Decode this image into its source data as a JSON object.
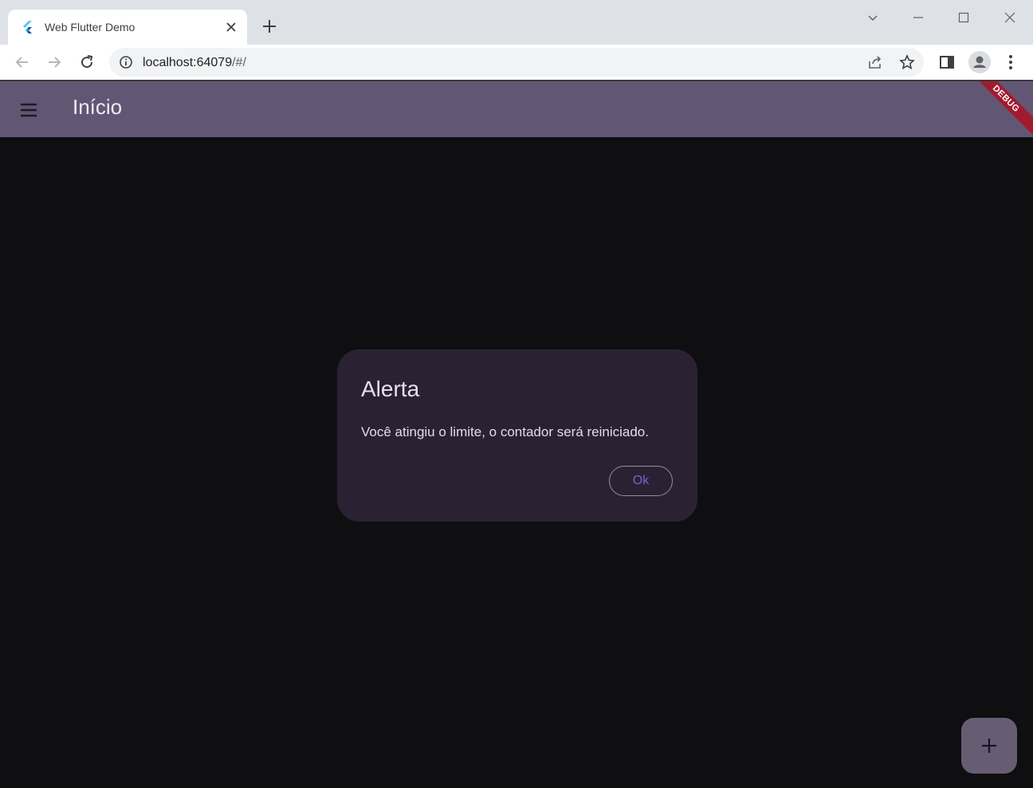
{
  "browser": {
    "tab": {
      "title": "Web Flutter Demo"
    },
    "url": {
      "host": "localhost:64079",
      "path": "/#/"
    }
  },
  "app": {
    "title": "Início",
    "debug_label": "DEBUG"
  },
  "dialog": {
    "title": "Alerta",
    "message": "Você atingiu o limite, o contador será reiniciado.",
    "ok_label": "Ok"
  },
  "colors": {
    "appbar": "#625674",
    "background": "#0f0e11",
    "dialog": "#2a2233",
    "fab": "#675d73",
    "debug_banner": "#a11b2e"
  }
}
